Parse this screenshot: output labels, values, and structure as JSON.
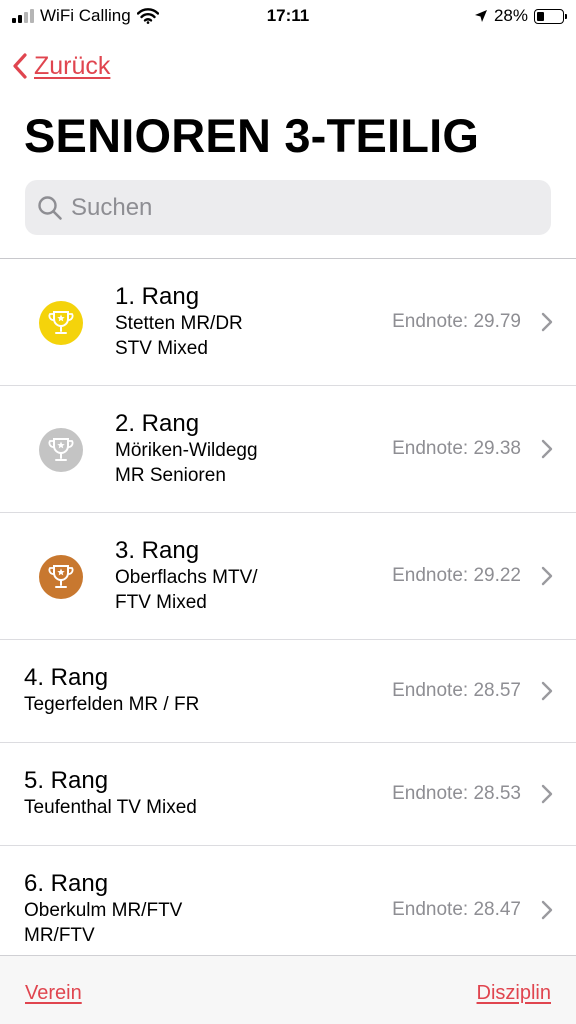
{
  "status_bar": {
    "carrier": "WiFi Calling",
    "time": "17:11",
    "battery": "28%",
    "battery_level": 0.28
  },
  "nav": {
    "back_label": "Zurück",
    "accent_color": "#e0454f"
  },
  "page": {
    "title": "SENIOREN 3-TEILIG"
  },
  "search": {
    "placeholder": "Suchen",
    "value": ""
  },
  "results": [
    {
      "rank": "1. Rang",
      "team_line1": "Stetten MR/DR",
      "team_line2": "STV Mixed",
      "score": "Endnote: 29.79",
      "trophy": "gold",
      "trophy_color": "#f4d30b"
    },
    {
      "rank": "2. Rang",
      "team_line1": "Möriken-Wildegg",
      "team_line2": "MR Senioren",
      "score": "Endnote: 29.38",
      "trophy": "silver",
      "trophy_color": "#c4c4c4"
    },
    {
      "rank": "3. Rang",
      "team_line1": "Oberflachs MTV/",
      "team_line2": "FTV Mixed",
      "score": "Endnote: 29.22",
      "trophy": "bronze",
      "trophy_color": "#c8782f"
    },
    {
      "rank": "4. Rang",
      "team_line1": "Tegerfelden MR / FR",
      "team_line2": "",
      "score": "Endnote: 28.57"
    },
    {
      "rank": "5. Rang",
      "team_line1": "Teufenthal TV Mixed",
      "team_line2": "",
      "score": "Endnote: 28.53"
    },
    {
      "rank": "6. Rang",
      "team_line1": "Oberkulm MR/FTV",
      "team_line2": "MR/FTV",
      "score": "Endnote: 28.47"
    }
  ],
  "bottom_bar": {
    "left_label": "Verein",
    "right_label": "Disziplin"
  },
  "icons": {
    "back": "chevron-left-icon",
    "search": "search-icon",
    "row": "chevron-right-icon",
    "trophy": "trophy-icon",
    "wifi": "wifi-icon",
    "location": "location-arrow-icon",
    "battery": "battery-icon"
  }
}
